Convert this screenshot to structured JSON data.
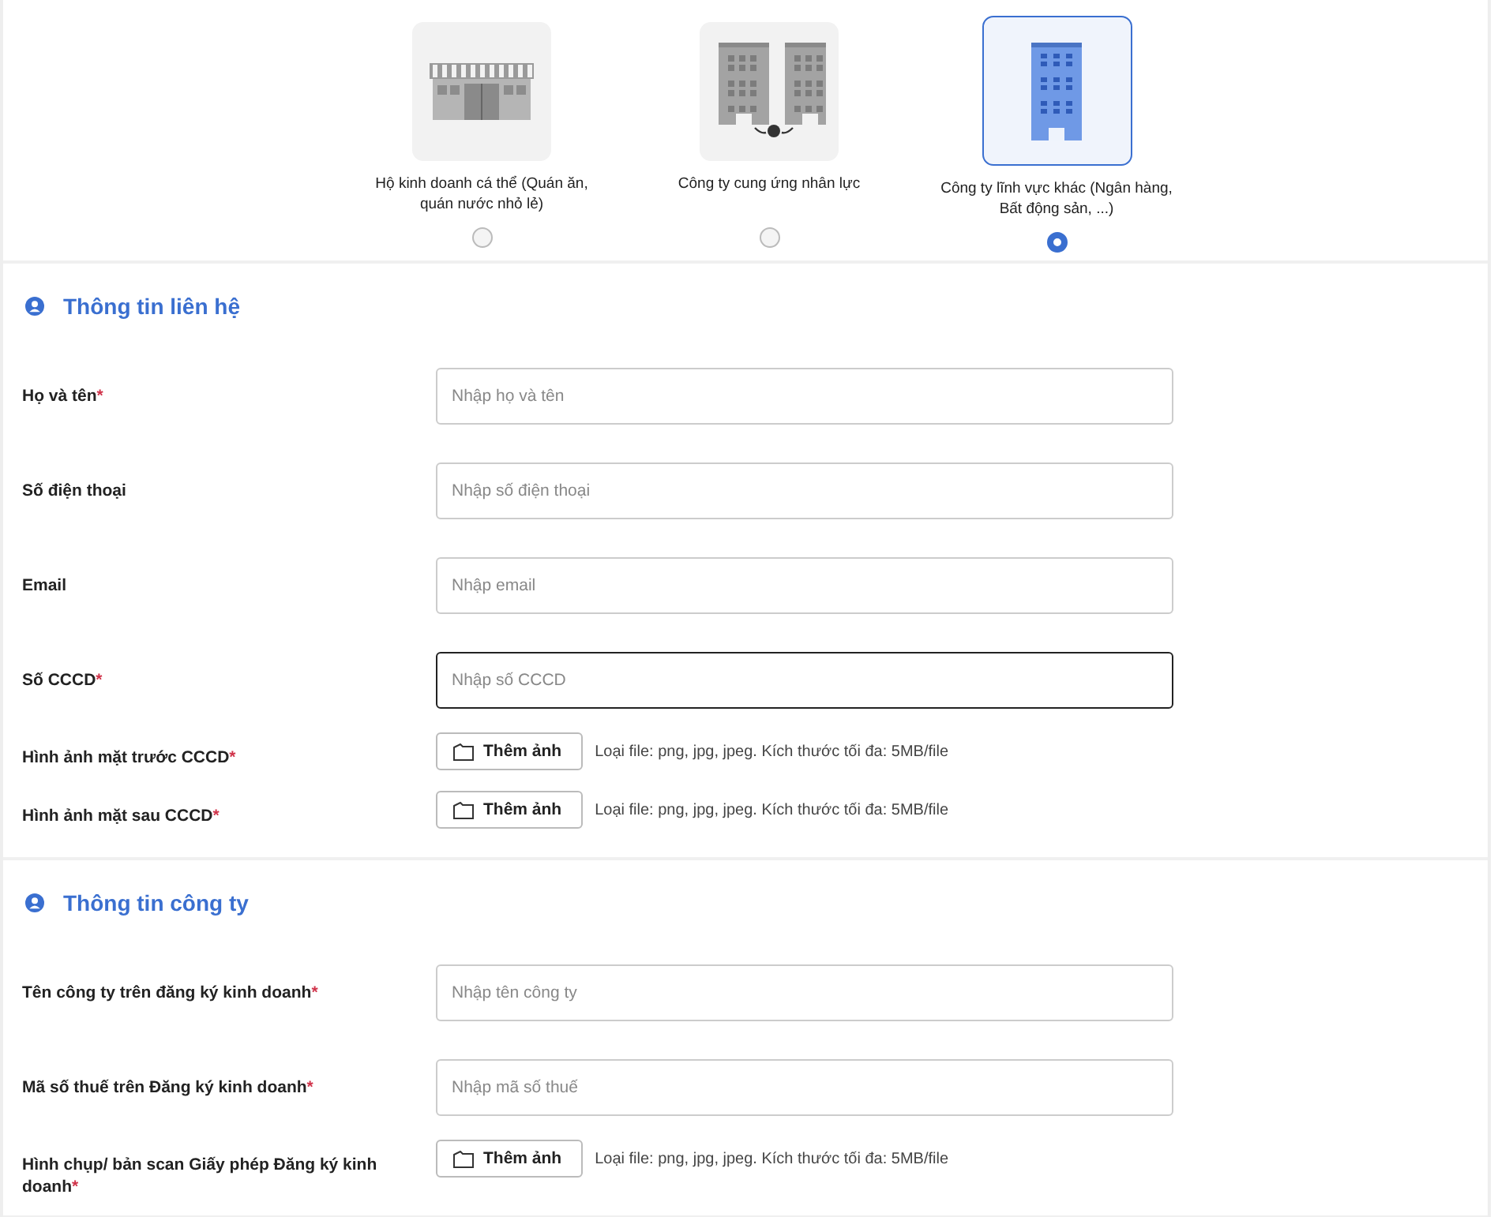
{
  "business_types": [
    {
      "kind": "shop",
      "label": "Hộ kinh doanh cá thể (Quán ăn, quán nước nhỏ lẻ)",
      "selected": false
    },
    {
      "kind": "agency",
      "label": "Công ty cung ứng nhân lực",
      "selected": false
    },
    {
      "kind": "office",
      "label": "Công ty lĩnh vực khác (Ngân hàng, Bất động sản, ...)",
      "selected": true
    }
  ],
  "sections": [
    {
      "title": "Thông tin liên hệ",
      "fields": [
        {
          "kind": "text",
          "label": "Họ và tên",
          "required_mark": "*",
          "placeholder": "Nhập họ và tên",
          "focused": false
        },
        {
          "kind": "text",
          "label": "Số điện thoại",
          "placeholder": "Nhập số điện thoại",
          "focused": false
        },
        {
          "kind": "text",
          "label": "Email",
          "placeholder": "Nhập email",
          "focused": false
        },
        {
          "kind": "text",
          "label": "Số CCCD",
          "required_mark": "*",
          "placeholder": "Nhập số CCCD",
          "focused": true
        },
        {
          "kind": "file",
          "label": "Hình ảnh mặt trước CCCD",
          "required_mark": "*",
          "button": "Thêm ảnh",
          "hint": "Loại file: png, jpg, jpeg. Kích thước tối đa: 5MB/file"
        },
        {
          "kind": "file",
          "label": "Hình ảnh mặt sau CCCD",
          "required_mark": "*",
          "button": "Thêm ảnh",
          "hint": "Loại file: png, jpg, jpeg. Kích thước tối đa: 5MB/file"
        }
      ]
    },
    {
      "title": "Thông tin công ty",
      "fields": [
        {
          "kind": "text",
          "label": "Tên công ty trên đăng ký kinh doanh",
          "required_mark": "*",
          "placeholder": "Nhập tên công ty",
          "focused": false
        },
        {
          "kind": "text",
          "label": "Mã số thuế trên Đăng ký kinh doanh",
          "required_mark": "*",
          "placeholder": "Nhập mã số thuế",
          "focused": false
        },
        {
          "kind": "file",
          "label": "Hình chụp/ bản scan Giấy phép Đăng ký kinh doanh",
          "required_mark": "*",
          "button": "Thêm ảnh",
          "hint": "Loại file: png, jpg, jpeg. Kích thước tối đa: 5MB/file"
        }
      ]
    }
  ]
}
